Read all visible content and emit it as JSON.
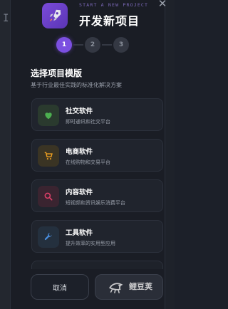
{
  "backdrop": {
    "left_ghost_text": "I"
  },
  "header": {
    "subtitle": "START A NEW PROJECT",
    "title": "开发新项目",
    "logo_icon": "rocket-icon",
    "close_icon": "close-icon",
    "close_glyph": "✕"
  },
  "steps": [
    {
      "label": "1",
      "state": "active"
    },
    {
      "label": "2",
      "state": "inactive"
    },
    {
      "label": "3",
      "state": "inactive"
    }
  ],
  "section": {
    "title": "选择项目模版",
    "description": "基于行业最佳实践的标准化解决方案"
  },
  "templates": [
    {
      "name": "社交软件",
      "description": "即时通讯和社交平台",
      "icon": "heart-icon",
      "icon_color": "#4caf50",
      "tile_color": "#2a3a2e"
    },
    {
      "name": "电商软件",
      "description": "在线购物和交易平台",
      "icon": "cart-icon",
      "icon_color": "#f0a020",
      "tile_color": "#3a3424"
    },
    {
      "name": "内容软件",
      "description": "短视频和资讯娱乐消费平台",
      "icon": "search-icon",
      "icon_color": "#e0406a",
      "tile_color": "#3a2430"
    },
    {
      "name": "工具软件",
      "description": "提升效率的实用型应用",
      "icon": "wrench-icon",
      "icon_color": "#4a90e2",
      "tile_color": "#24303e"
    }
  ],
  "footer": {
    "cancel_label": "取消",
    "next_label": ""
  },
  "watermark": {
    "text": "鲤豆荚"
  },
  "colors": {
    "accent": "#7b4fe0",
    "background": "#1a1d25"
  }
}
